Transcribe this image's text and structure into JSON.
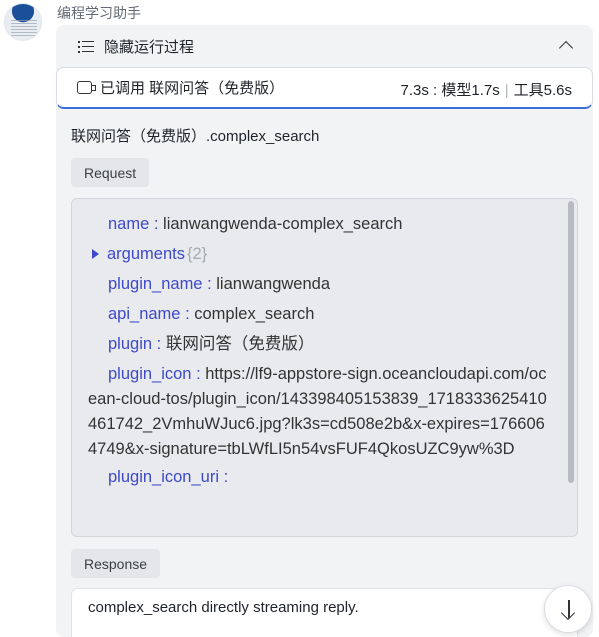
{
  "bot": {
    "name": "编程学习助手"
  },
  "process": {
    "toggle_label": "隐藏运行过程",
    "called_label": "已调用 联网问答（免费版）",
    "timing": {
      "total": "7.3s",
      "model": "模型1.7s",
      "tool": "工具5.6s"
    }
  },
  "tool": {
    "title": "联网问答（免费版）.complex_search",
    "request_label": "Request",
    "response_label": "Response",
    "fields": {
      "name": {
        "key": "name",
        "value": "lianwangwenda-complex_search"
      },
      "arguments": {
        "key": "arguments",
        "count": "{2}"
      },
      "plugin_name": {
        "key": "plugin_name",
        "value": "lianwangwenda"
      },
      "api_name": {
        "key": "api_name",
        "value": "complex_search"
      },
      "plugin": {
        "key": "plugin",
        "value": "联网问答（免费版）"
      },
      "plugin_icon": {
        "key": "plugin_icon",
        "value": "https://lf9-appstore-sign.oceancloudapi.com/ocean-cloud-tos/plugin_icon/143398405153839_1718333625410461742_2VmhuWJuc6.jpg?lk3s=cd508e2b&x-expires=1766064749&x-signature=tbLWfLI5n54vsFUF4QkosUZC9yw%3D"
      },
      "plugin_icon_uri": {
        "key": "plugin_icon_uri"
      }
    },
    "response_text": "complex_search directly streaming reply."
  },
  "icons": {
    "list": "list-icon",
    "chevron": "chevron-up-icon",
    "plugin": "plugin-icon",
    "scroll": "arrow-down-icon"
  },
  "colors": {
    "key": "#3d49c9",
    "accent": "#3b6fd8"
  }
}
